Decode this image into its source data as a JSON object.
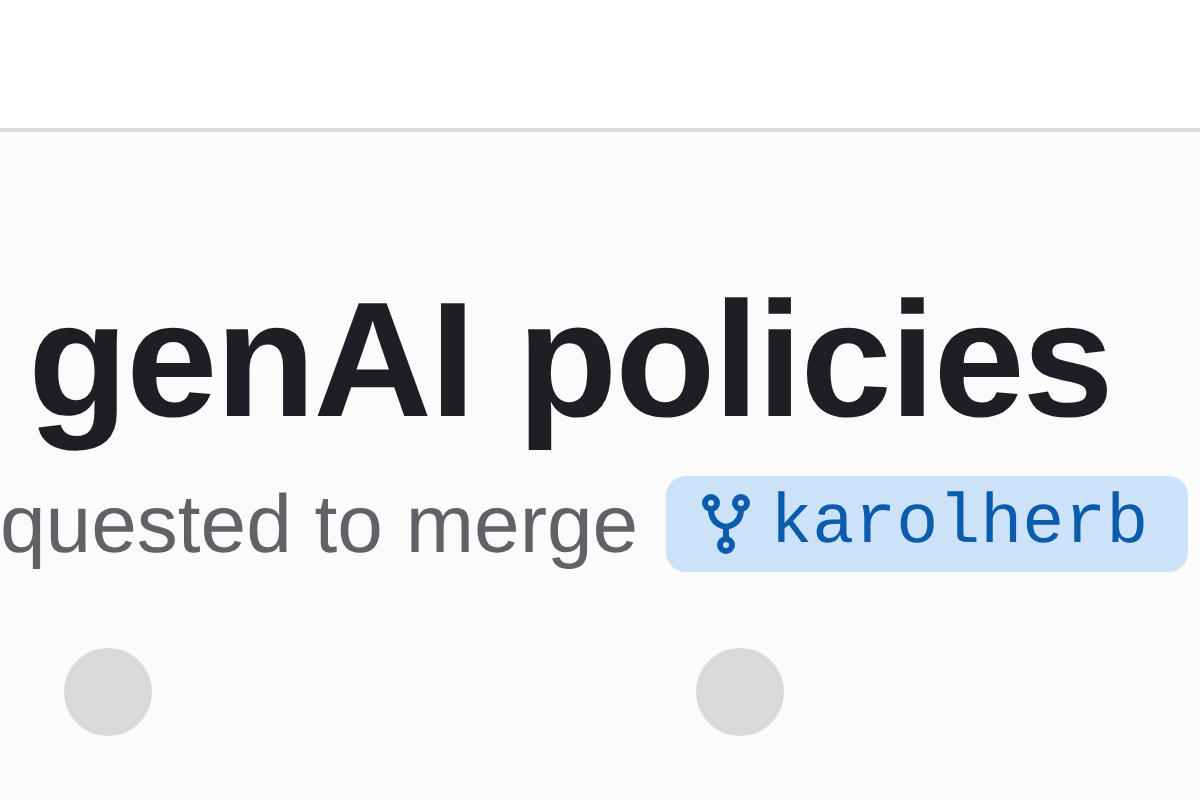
{
  "title": "genAI policies",
  "subtitle": {
    "text": "quested to merge",
    "branch": "karolherb"
  }
}
